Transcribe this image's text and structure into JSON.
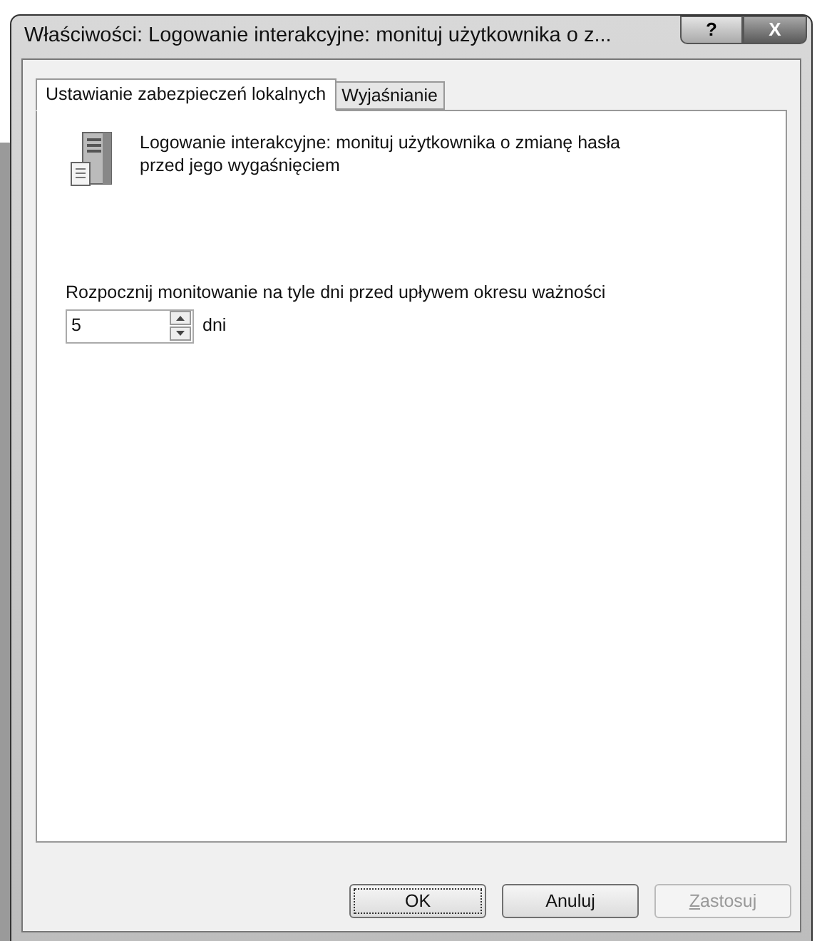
{
  "window": {
    "title": "Właściwości: Logowanie interakcyjne: monituj użytkownika o z...",
    "title_buttons": [
      {
        "kind": "help",
        "label": "?"
      },
      {
        "kind": "close",
        "label": "X"
      }
    ]
  },
  "tabs": [
    {
      "label": "Ustawianie zabezpieczeń lokalnych",
      "selected": true
    },
    {
      "label": "Wyjaśnianie",
      "selected": false
    }
  ],
  "policy": {
    "description": "Logowanie interakcyjne: monituj użytkownika o zmianę hasła przed jego wygaśnięciem"
  },
  "setting": {
    "label": "Rozpocznij monitowanie na tyle dni przed upływem okresu ważności",
    "value": "5",
    "unit": "dni"
  },
  "buttons": [
    {
      "label": "OK",
      "default": true,
      "disabled": false
    },
    {
      "label": "Anuluj",
      "default": false,
      "disabled": false
    },
    {
      "label": "Zastosuj",
      "default": false,
      "disabled": true
    }
  ]
}
